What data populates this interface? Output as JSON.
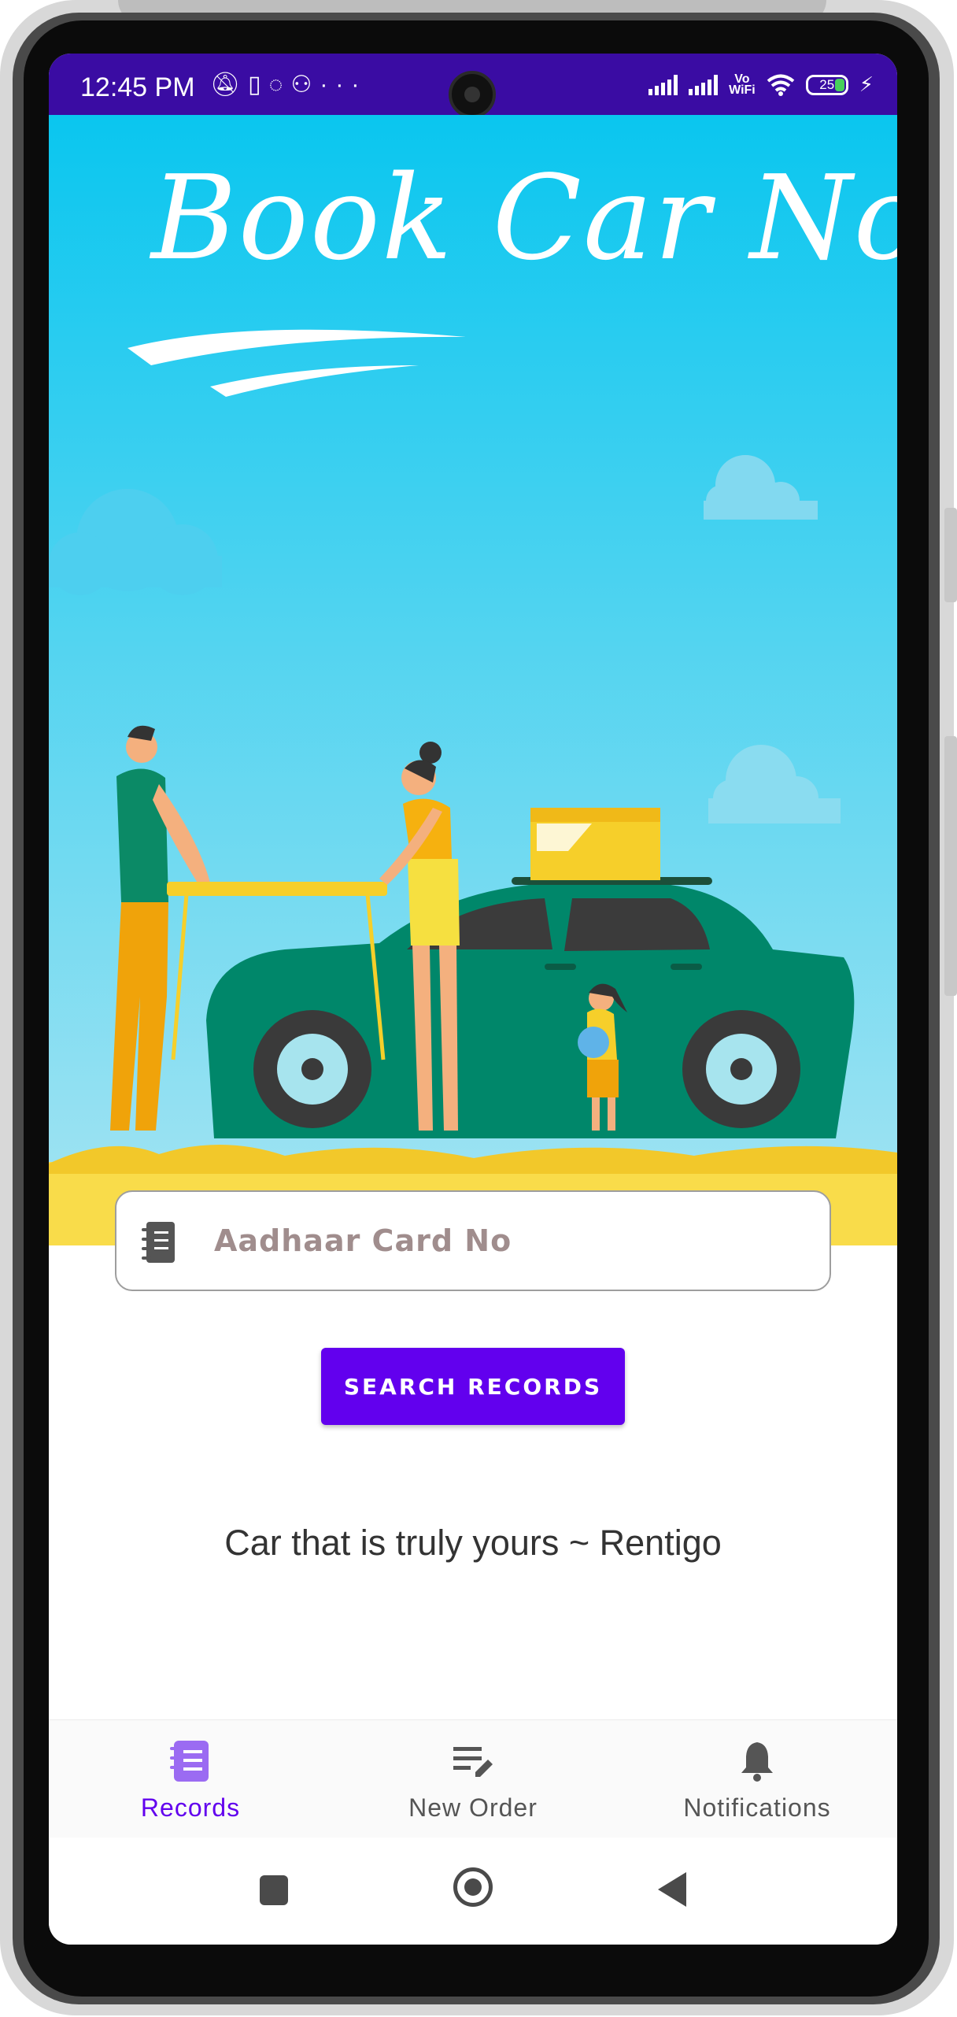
{
  "statusbar": {
    "time": "12:45 PM",
    "left_icons": [
      "notifications-off-icon",
      "sim-icon",
      "sync-icon",
      "incognito-icon",
      "more-icon"
    ],
    "right_icons": [
      "signal-icon",
      "signal-icon",
      "vowifi-icon",
      "wifi-icon",
      "battery-icon",
      "charging-icon"
    ],
    "vowifi_top": "Vo",
    "vowifi_bottom": "WiFi",
    "battery_level": "25",
    "more": "···"
  },
  "hero": {
    "title": "Book Car Now",
    "colors": {
      "sky_top": "#0ac6ef",
      "sky_bottom": "#9ee3f2",
      "sand": "#f9dc4a",
      "car": "#00876a"
    }
  },
  "search": {
    "placeholder": "Aadhaar Card No",
    "icon": "notebook-icon",
    "button_label": "SEARCH RECORDS",
    "accent": "#6200ee"
  },
  "tagline": "Car that is truly yours  ~ Rentigo",
  "bottom_nav": {
    "items": [
      {
        "label": "Records",
        "icon": "records-icon",
        "active": true
      },
      {
        "label": "New Order",
        "icon": "edit-list-icon",
        "active": false
      },
      {
        "label": "Notifications",
        "icon": "bell-icon",
        "active": false
      }
    ]
  },
  "system_nav": [
    "recents-button",
    "home-button",
    "back-button"
  ]
}
